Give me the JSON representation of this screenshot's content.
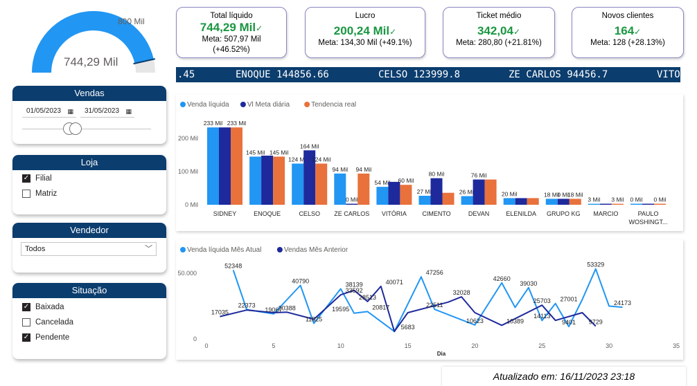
{
  "colors": {
    "accent_navy": "#0b3d6e",
    "light_blue": "#2196f3",
    "dark_blue": "#1e2a9c",
    "orange": "#e8713c",
    "green": "#1a9641"
  },
  "gauge": {
    "value_label": "744,29 Mil",
    "target_label": "800 Mil",
    "value": 744.29,
    "max": 800
  },
  "kpis": [
    {
      "title": "Total líquido",
      "value": "744,29 Mil",
      "meta_line1": "Meta: 507,97 Mil",
      "meta_line2": "(+46.52%)"
    },
    {
      "title": "Lucro",
      "value": "200,24 Mil",
      "meta_line1": "Meta: 134,30 Mil (+49.1%)",
      "meta_line2": ""
    },
    {
      "title": "Ticket médio",
      "value": "342,04",
      "meta_line1": "Meta: 280,80 (+21.81%)",
      "meta_line2": ""
    },
    {
      "title": "Novos clientes",
      "value": "164",
      "meta_line1": "Meta: 128 (+28.13%)",
      "meta_line2": ""
    }
  ],
  "ticker": {
    "items": [
      ".45",
      "ENOQUE 144856.66",
      "CELSO 123999.8",
      "ZE CARLOS 94456.7",
      "VITO"
    ]
  },
  "slicers": {
    "vendas": {
      "title": "Vendas",
      "date_start": "01/05/2023",
      "date_end": "31/05/2023"
    },
    "loja": {
      "title": "Loja",
      "options": [
        {
          "label": "Filial",
          "checked": true
        },
        {
          "label": "Matriz",
          "checked": false
        }
      ]
    },
    "vendedor": {
      "title": "Vendedor",
      "selected": "Todos"
    },
    "situacao": {
      "title": "Situação",
      "options": [
        {
          "label": "Baixada",
          "checked": true
        },
        {
          "label": "Cancelada",
          "checked": false
        },
        {
          "label": "Pendente",
          "checked": true
        }
      ]
    }
  },
  "chart_data": [
    {
      "type": "bar",
      "categories": [
        "SIDNEY",
        "ENOQUE",
        "CELSO",
        "ZE CARLOS",
        "VITÓRIA",
        "CIMENTO",
        "DEVAN",
        "ELENILDA",
        "GRUPO KG",
        "MARCIO",
        "PAULO WOSHINGT..."
      ],
      "series": [
        {
          "name": "Venda líquida",
          "values": [
            233,
            145,
            124,
            94,
            54,
            27,
            26,
            20,
            18,
            3,
            0
          ],
          "labels": [
            "233 Mil",
            "145 Mil",
            "124 Mil",
            "94 Mil",
            "54 Mil",
            "27 Mil",
            "26 Mil",
            "20 Mil",
            "18 Mil",
            "3 Mil",
            "0 Mil"
          ]
        },
        {
          "name": "Vl Meta diária",
          "values": [
            233,
            148,
            164,
            0,
            69,
            80,
            76,
            20,
            18,
            0,
            0
          ],
          "labels": [
            "",
            "",
            "164 Mil",
            "0 Mil",
            "",
            "80 Mil",
            "76 Mil",
            "",
            "0 Mil",
            "",
            ""
          ]
        },
        {
          "name": "Tendencia real",
          "values": [
            233,
            145,
            124,
            94,
            60,
            36,
            76,
            20,
            18,
            3,
            0
          ],
          "labels": [
            "233 Mil",
            "145 Mil",
            "124 Mil",
            "94 Mil",
            "60 Mil",
            "",
            "",
            "",
            "18 Mil",
            "3 Mil",
            "0 Mil"
          ]
        }
      ],
      "y_ticks": [
        "0 Mil",
        "100 Mil",
        "200 Mil"
      ],
      "ylim": [
        0,
        250
      ],
      "legend_position": "top-left"
    },
    {
      "type": "line",
      "xlabel": "Dia",
      "xlim": [
        0,
        35
      ],
      "ylim": [
        0,
        60000
      ],
      "x_ticks": [
        "0",
        "5",
        "10",
        "15",
        "20",
        "25",
        "30",
        "35"
      ],
      "y_ticks": [
        "0",
        "50.000"
      ],
      "legend_position": "top-left",
      "series": [
        {
          "name": "Venda líquida Mês Atual",
          "x": [
            2,
            3,
            5,
            7,
            8,
            10,
            11,
            12,
            14,
            16,
            17,
            20,
            22,
            23,
            24,
            25,
            26,
            27,
            28,
            29,
            30,
            31
          ],
          "y": [
            52348,
            22373,
            19067,
            40790,
            11825,
            38139,
            19595,
            20817,
            5683,
            47256,
            22511,
            10623,
            42660,
            24000,
            39030,
            14000,
            27001,
            9401,
            30000,
            53329,
            25000,
            24173
          ]
        },
        {
          "name": "Vendas Mês Anterior",
          "x": [
            1,
            3,
            5,
            6,
            8,
            10,
            11,
            12,
            13,
            14,
            15,
            18,
            19,
            20,
            22,
            25,
            26,
            28,
            29
          ],
          "y": [
            17035,
            22000,
            20000,
            20388,
            15000,
            33592,
            37000,
            28513,
            40071,
            5683,
            20000,
            28000,
            32028,
            20000,
            10389,
            25703,
            14113,
            20000,
            9729
          ]
        }
      ],
      "point_labels": [
        {
          "x": 2,
          "y": 52348,
          "text": "52348"
        },
        {
          "x": 3,
          "y": 22373,
          "text": "22373"
        },
        {
          "x": 5,
          "y": 19067,
          "text": "19067"
        },
        {
          "x": 1,
          "y": 17035,
          "text": "17035"
        },
        {
          "x": 6,
          "y": 20388,
          "text": "20388"
        },
        {
          "x": 7,
          "y": 40790,
          "text": "40790"
        },
        {
          "x": 8,
          "y": 11825,
          "text": "11825"
        },
        {
          "x": 10,
          "y": 19595,
          "text": "19595"
        },
        {
          "x": 11,
          "y": 38139,
          "text": "38139"
        },
        {
          "x": 11,
          "y": 33592,
          "text": "33592"
        },
        {
          "x": 12,
          "y": 28513,
          "text": "28513"
        },
        {
          "x": 13,
          "y": 20817,
          "text": "20817"
        },
        {
          "x": 14,
          "y": 40071,
          "text": "40071"
        },
        {
          "x": 15,
          "y": 5683,
          "text": "5683"
        },
        {
          "x": 17,
          "y": 47256,
          "text": "47256"
        },
        {
          "x": 17,
          "y": 22511,
          "text": "22511"
        },
        {
          "x": 19,
          "y": 32028,
          "text": "32028"
        },
        {
          "x": 20,
          "y": 10623,
          "text": "10623"
        },
        {
          "x": 22,
          "y": 42660,
          "text": "42660"
        },
        {
          "x": 23,
          "y": 10389,
          "text": "10389"
        },
        {
          "x": 24,
          "y": 39030,
          "text": "39030"
        },
        {
          "x": 25,
          "y": 25703,
          "text": "25703"
        },
        {
          "x": 25,
          "y": 14113,
          "text": "14113"
        },
        {
          "x": 27,
          "y": 27001,
          "text": "27001"
        },
        {
          "x": 27,
          "y": 9401,
          "text": "9401"
        },
        {
          "x": 29,
          "y": 53329,
          "text": "53329"
        },
        {
          "x": 29,
          "y": 9729,
          "text": "9729"
        },
        {
          "x": 31,
          "y": 24173,
          "text": "24173"
        }
      ]
    }
  ],
  "footer": {
    "updated": "Atualizado em: 16/11/2023 23:18"
  }
}
